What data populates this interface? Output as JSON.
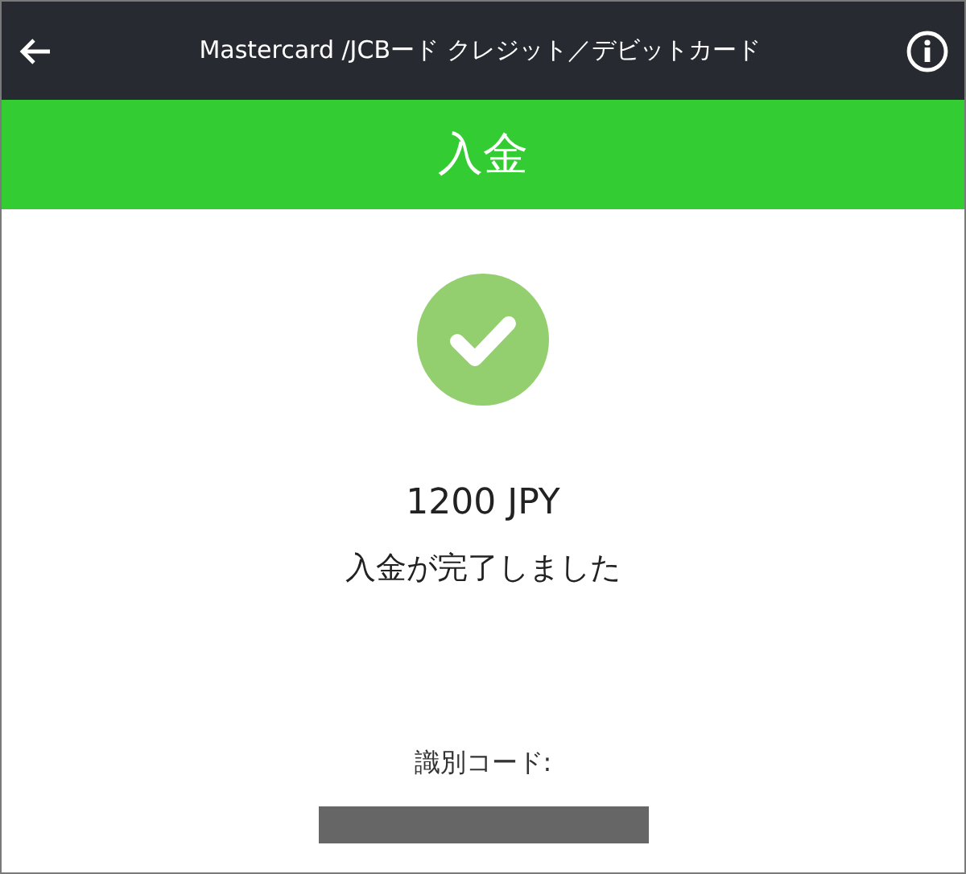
{
  "header": {
    "title": "Mastercard /JCBード クレジット／デビットカード"
  },
  "banner": {
    "title": "入金"
  },
  "result": {
    "amount": "1200 JPY",
    "message": "入金が完了しました"
  },
  "code": {
    "label": "識別コード:"
  }
}
